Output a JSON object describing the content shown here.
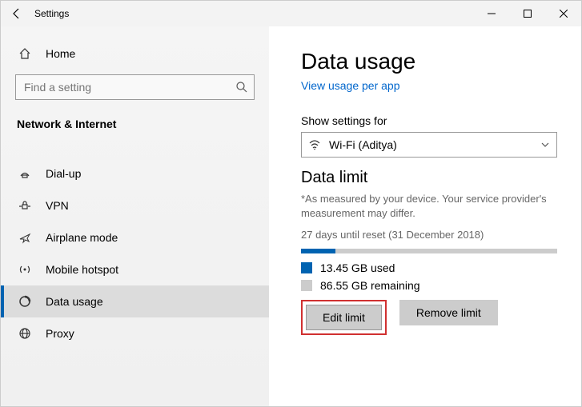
{
  "titlebar": {
    "title": "Settings"
  },
  "sidebar": {
    "home_label": "Home",
    "search_placeholder": "Find a setting",
    "group_title": "Network & Internet",
    "items": [
      {
        "label": "Dial-up"
      },
      {
        "label": "VPN"
      },
      {
        "label": "Airplane mode"
      },
      {
        "label": "Mobile hotspot"
      },
      {
        "label": "Data usage"
      },
      {
        "label": "Proxy"
      }
    ]
  },
  "main": {
    "heading": "Data usage",
    "view_link": "View usage per app",
    "show_settings_label": "Show settings for",
    "dropdown_value": "Wi-Fi (Aditya)",
    "data_limit_heading": "Data limit",
    "note": "*As measured by your device. Your service provider's measurement may differ.",
    "reset_info": "27 days until reset (31 December 2018)",
    "usage": {
      "used_label": "13.45 GB used",
      "remaining_label": "86.55 GB remaining",
      "used_percent": 13.45
    },
    "edit_button": "Edit limit",
    "remove_button": "Remove limit"
  },
  "colors": {
    "accent": "#0063b1",
    "link": "#0066cc"
  }
}
